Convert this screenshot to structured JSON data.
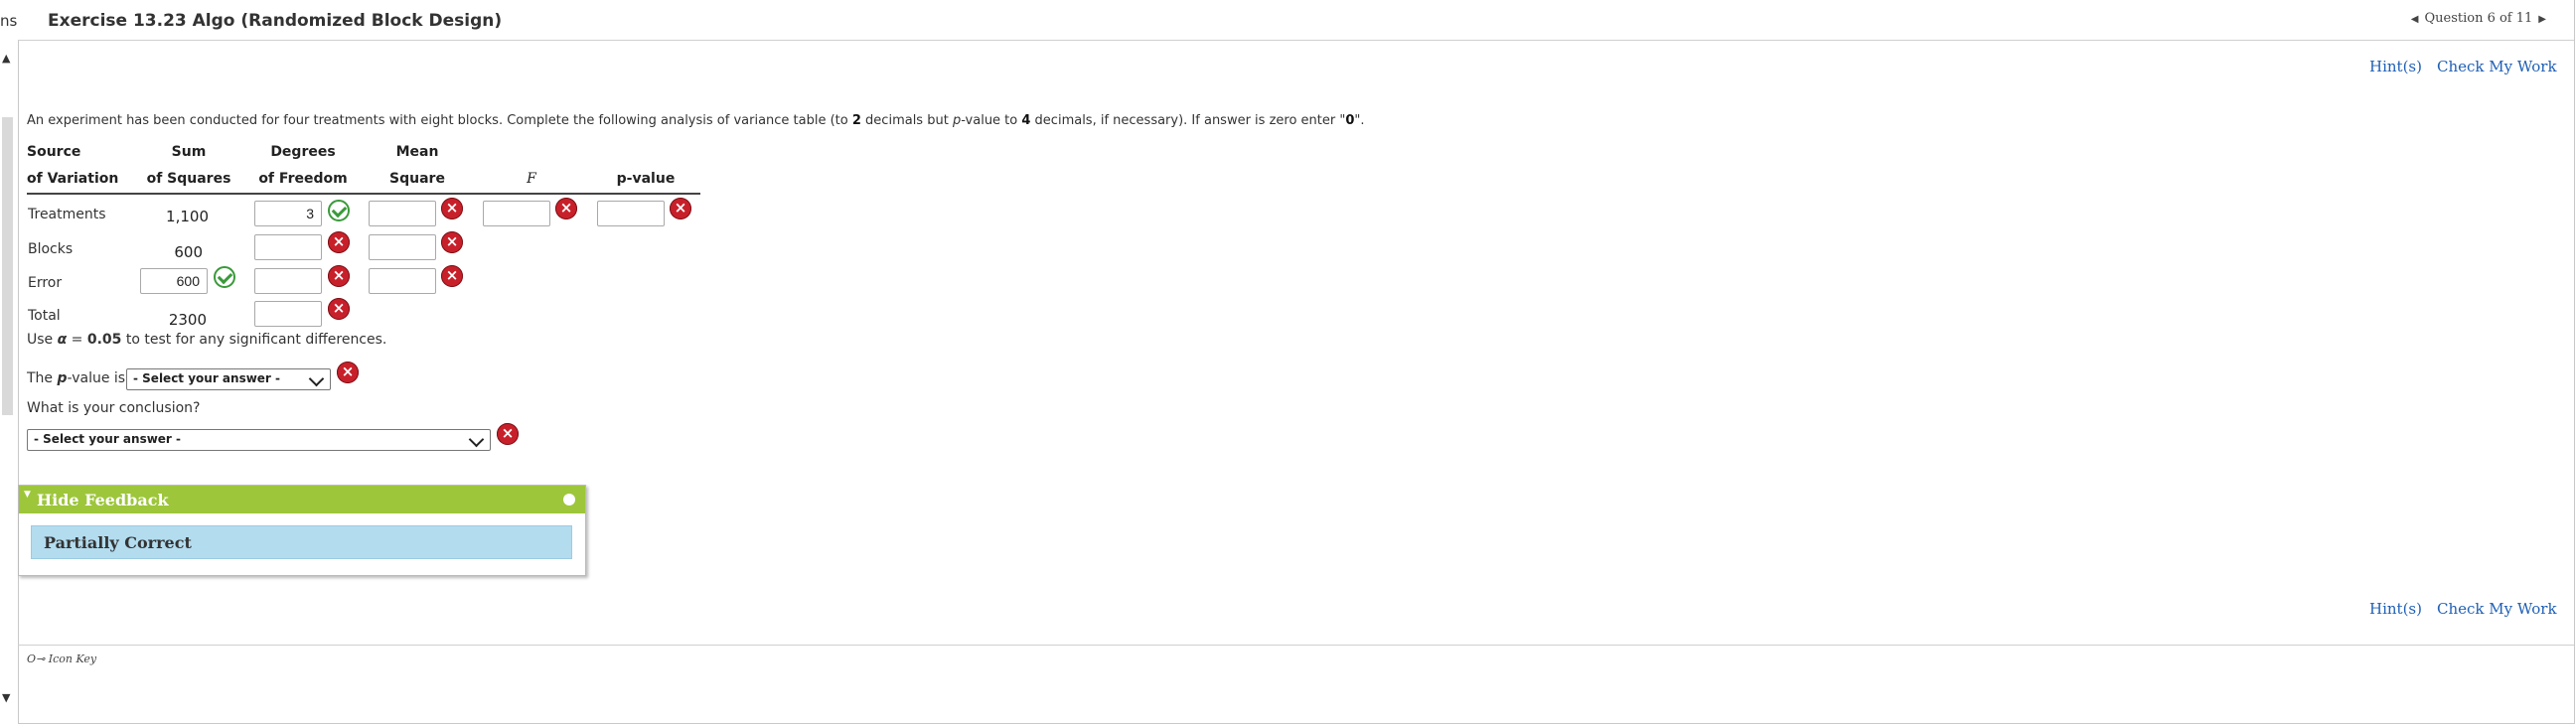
{
  "page": {
    "left_label": "ns",
    "title": "Exercise 13.23 Algo (Randomized Block Design)",
    "question_nav": "Question 6 of 11",
    "hint_label": "Hint(s)",
    "check_label": "Check My Work"
  },
  "intro": {
    "prefix": "An experiment has been conducted for four treatments with eight blocks. Complete the following analysis of variance table (to ",
    "dec1": "2",
    "mid": " decimals but ",
    "pval": "p",
    "mid2": "-value to ",
    "dec2": "4",
    "suffix": " decimals, if necessary). If answer is zero enter \"",
    "zero": "0",
    "end": "\"."
  },
  "table": {
    "headers": {
      "source_1": "Source",
      "source_2": "of Variation",
      "ss_1": "Sum",
      "ss_2": "of Squares",
      "df_1": "Degrees",
      "df_2": "of Freedom",
      "ms_1": "Mean",
      "ms_2": "Square",
      "f": "F",
      "p": "p-value"
    },
    "rows": {
      "treatments": {
        "label": "Treatments",
        "ss": "1,100",
        "df": "3"
      },
      "blocks": {
        "label": "Blocks",
        "ss": "600"
      },
      "error": {
        "label": "Error",
        "ss": "600"
      },
      "total": {
        "label": "Total",
        "ss": "2300"
      }
    }
  },
  "alpha": {
    "prefix": "Use ",
    "symbol": "α",
    "eq": " = ",
    "value": "0.05",
    "suffix": " to test for any significant differences."
  },
  "pvalue_q": {
    "prefix": "The ",
    "p": "p",
    "suffix": "-value is",
    "select": "- Select your answer -"
  },
  "conclusion": {
    "question": "What is your conclusion?",
    "select": "- Select your answer -"
  },
  "feedback": {
    "toggle": "Hide Feedback",
    "result": "Partially Correct"
  },
  "footer": {
    "icon_key": "Icon Key"
  },
  "colors": {
    "link": "#1f5fb5",
    "correct": "#3a9a3a",
    "incorrect": "#c8202a",
    "feedback_head": "#9dc63b",
    "feedback_body": "#b3dcef"
  }
}
